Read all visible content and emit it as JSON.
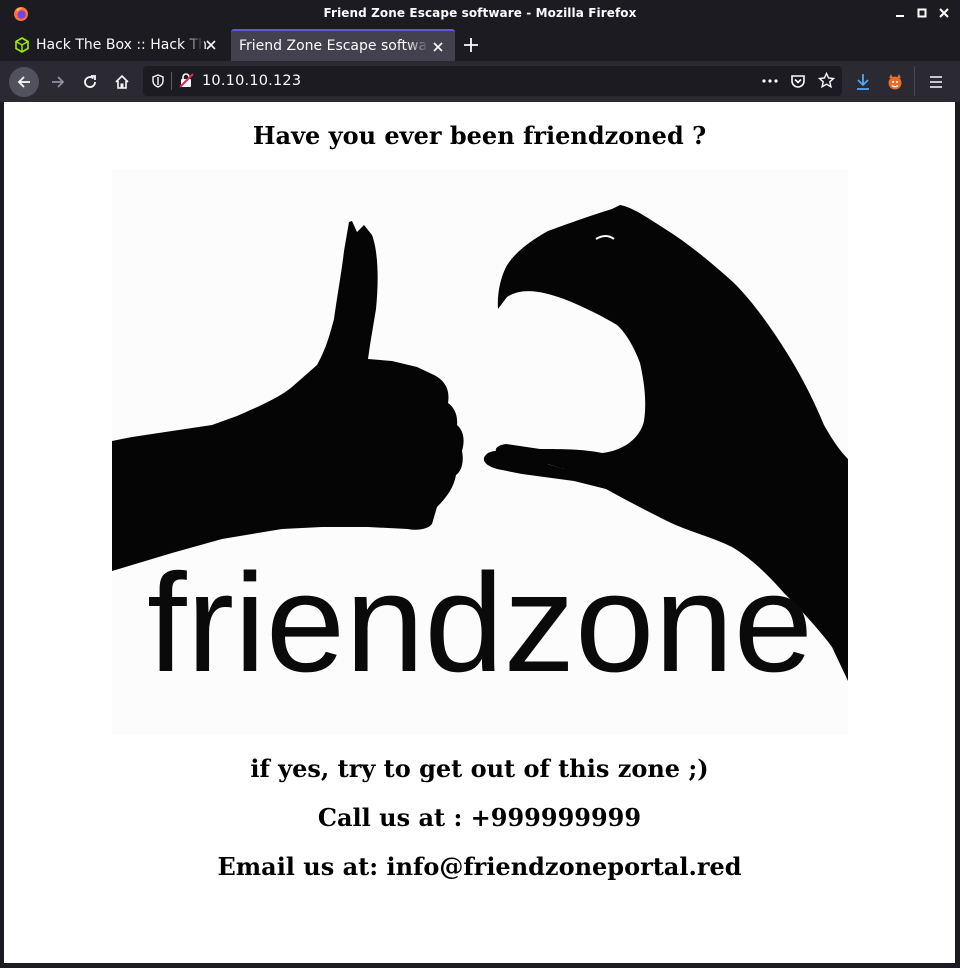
{
  "window": {
    "title": "Friend Zone Escape software - Mozilla Firefox"
  },
  "tabs": [
    {
      "label": "Hack The Box :: Hack The Box",
      "icon": "htb-cube-icon",
      "active": false
    },
    {
      "label": "Friend Zone Escape software",
      "icon": "none",
      "active": true
    }
  ],
  "toolbar": {
    "url": "10.10.10.123"
  },
  "page": {
    "heading": "Have you ever been friendzoned ?",
    "image_word": "friendzone",
    "line1": "if yes, try to get out of this zone ;)",
    "line2": "Call us at : +999999999",
    "line3": "Email us at: info@friendzoneportal.red"
  },
  "colors": {
    "chrome": "#1c1b22",
    "toolbar": "#2b2a33",
    "active_tab": "#42414d",
    "accent": "#5b5bd6",
    "download": "#54a5f2",
    "htb_green": "#9fef00"
  }
}
